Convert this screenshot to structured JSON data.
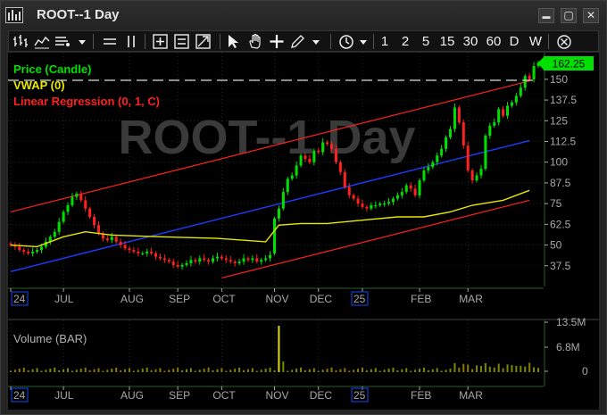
{
  "window": {
    "title": "ROOT--1 Day"
  },
  "window_controls": {
    "minimize": "▬",
    "maximize": "▢",
    "close": "✕"
  },
  "toolbar": {
    "intervals": [
      "1",
      "2",
      "5",
      "15",
      "30",
      "60",
      "D",
      "W"
    ]
  },
  "price_pane": {
    "watermark": "ROOT--1 Day",
    "legend": [
      {
        "text": "Price (Candle)",
        "color": "#00e000"
      },
      {
        "text": "VWAP (0)",
        "color": "#e8e800"
      },
      {
        "text": "Linear Regression (0, 1, C)",
        "color": "#ff2020"
      }
    ],
    "last_price": "162.25",
    "y_ticks": [
      "150",
      "137.5",
      "125",
      "112.5",
      "100",
      "87.5",
      "75",
      "62.5",
      "50",
      "37.5"
    ]
  },
  "volume_pane": {
    "legend": "Volume (BAR)",
    "y_ticks": [
      "13.5M",
      "6.8M",
      "0"
    ]
  },
  "x_axis": {
    "labels": [
      "24",
      "JUL",
      "AUG",
      "SEP",
      "OCT",
      "NOV",
      "DEC",
      "25",
      "FEB",
      "MAR"
    ]
  },
  "colors": {
    "up": "#00e000",
    "down": "#ff2020",
    "vwap": "#e8e800",
    "regression_mid": "#1e3cff",
    "regression_band": "#ff2020",
    "grid": "#1f4a1f",
    "axis_text": "#a8a8a8",
    "year_highlight": "#1240c8"
  },
  "chart_data": {
    "type": "candlestick",
    "title": "ROOT--1 Day",
    "series": [
      {
        "name": "Price (Candle)",
        "type": "candlestick",
        "close": [
          50,
          49,
          47,
          46,
          45,
          46,
          47,
          49,
          52,
          55,
          58,
          64,
          70,
          74,
          79,
          81,
          77,
          72,
          67,
          62,
          57,
          54,
          53,
          55,
          52,
          50,
          48,
          47,
          46,
          45,
          45,
          46,
          45,
          43,
          42,
          41,
          40,
          38,
          37,
          38,
          39,
          41,
          40,
          42,
          41,
          40,
          42,
          43,
          42,
          41,
          40,
          39,
          40,
          42,
          41,
          42,
          40,
          41,
          42,
          44,
          66,
          72,
          82,
          90,
          92,
          98,
          104,
          102,
          100,
          107,
          106,
          112,
          111,
          108,
          100,
          94,
          85,
          80,
          78,
          75,
          73,
          72,
          74,
          74,
          75,
          75,
          76,
          78,
          80,
          82,
          86,
          84,
          80,
          89,
          95,
          97,
          100,
          104,
          108,
          115,
          120,
          133,
          124,
          110,
          95,
          89,
          92,
          96,
          116,
          122,
          124,
          132,
          128,
          134,
          136,
          140,
          145,
          152,
          150,
          158,
          160
        ]
      },
      {
        "name": "VWAP (0)",
        "type": "line",
        "points": [
          [
            0,
            50
          ],
          [
            6,
            49
          ],
          [
            12,
            55
          ],
          [
            17,
            58
          ],
          [
            23,
            56
          ],
          [
            34,
            55
          ],
          [
            47,
            54
          ],
          [
            58,
            52
          ],
          [
            61,
            62
          ],
          [
            66,
            63
          ],
          [
            72,
            63
          ],
          [
            80,
            65
          ],
          [
            88,
            67
          ],
          [
            94,
            67
          ],
          [
            100,
            70
          ],
          [
            105,
            74
          ],
          [
            112,
            77
          ],
          [
            118,
            83
          ]
        ]
      },
      {
        "name": "Linear Regression (0, 1, C)",
        "type": "line",
        "points": [
          [
            0,
            34
          ],
          [
            118,
            113
          ]
        ]
      }
    ],
    "volume": {
      "name": "Volume (BAR)",
      "ylim": [
        0,
        13.5
      ],
      "spike_index": 61
    },
    "xlabels": [
      "24",
      "JUL",
      "AUG",
      "SEP",
      "OCT",
      "NOV",
      "DEC",
      "25",
      "FEB",
      "MAR"
    ],
    "ylim": [
      25,
      165
    ],
    "last_value": 162.25
  }
}
